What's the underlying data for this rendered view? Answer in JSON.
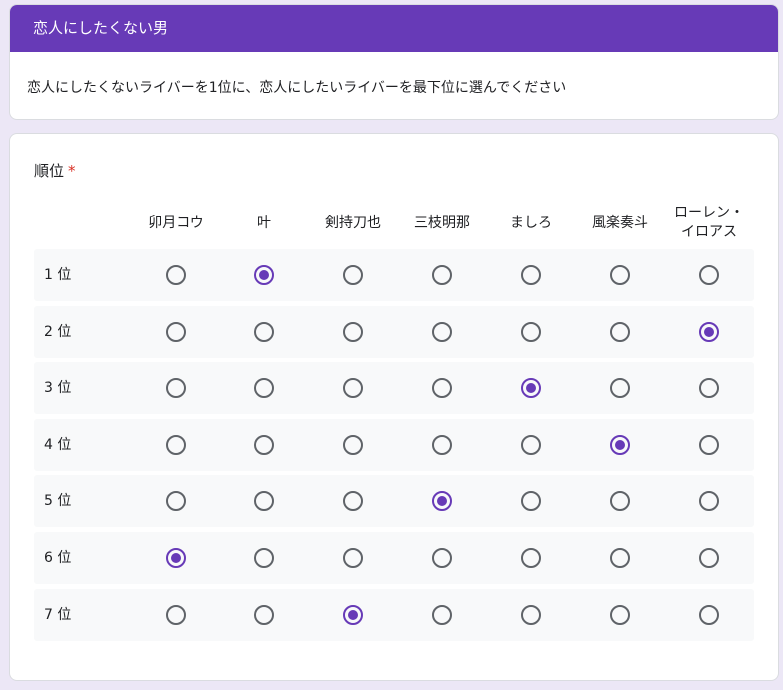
{
  "section": {
    "title": "恋人にしたくない男",
    "description": "恋人にしたくないライバーを1位に、恋人にしたいライバーを最下位に選んでください"
  },
  "question": {
    "title": "順位",
    "required_mark": "*",
    "columns": [
      "卯月コウ",
      "叶",
      "剣持刀也",
      "三枝明那",
      "ましろ",
      "風楽奏斗",
      "ローレン・\nイロアス"
    ],
    "rows": [
      {
        "label": "1 位",
        "selected_column": 1
      },
      {
        "label": "2 位",
        "selected_column": 6
      },
      {
        "label": "3 位",
        "selected_column": 4
      },
      {
        "label": "4 位",
        "selected_column": 5
      },
      {
        "label": "5 位",
        "selected_column": 3
      },
      {
        "label": "6 位",
        "selected_column": 0
      },
      {
        "label": "7 位",
        "selected_column": 2
      }
    ]
  },
  "colors": {
    "accent": "#673ab7",
    "required": "#d93025",
    "background": "#ece7f6"
  }
}
